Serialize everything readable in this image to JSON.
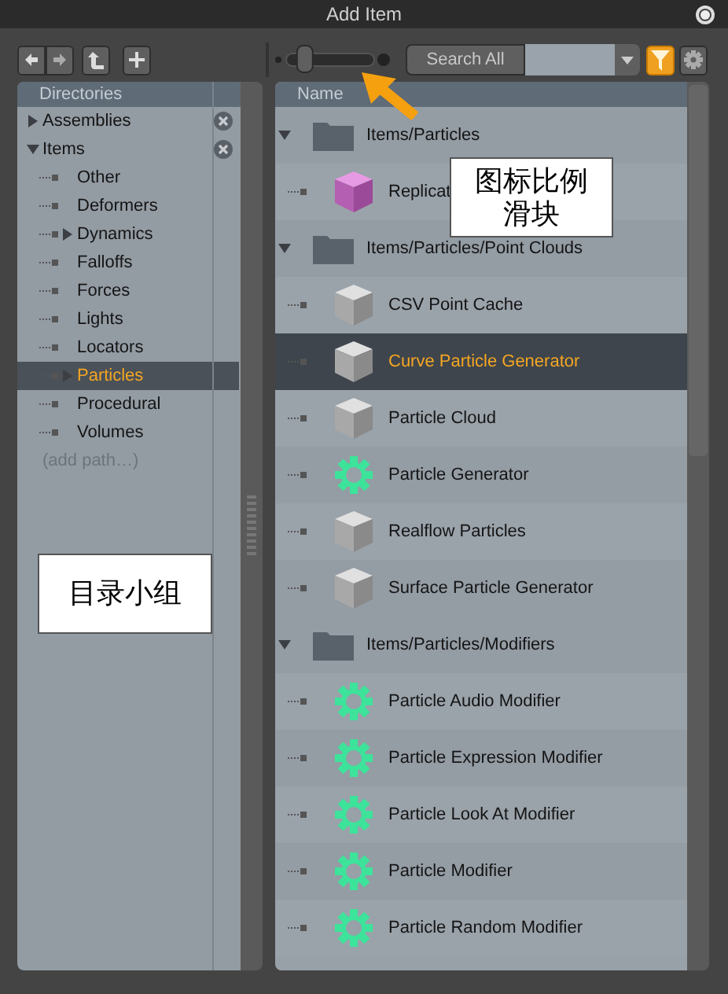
{
  "window": {
    "title": "Add Item"
  },
  "toolbar": {
    "icon_scale": {
      "level": 0.15
    },
    "search_button": "Search All",
    "filter_on": true
  },
  "directories": {
    "header": "Directories",
    "items": [
      {
        "label": "Assemblies",
        "kind": "branch",
        "expanded": false,
        "selected": false
      },
      {
        "label": "Items",
        "kind": "branch",
        "expanded": true,
        "selected": false,
        "children": [
          {
            "label": "Other",
            "kind": "leaf",
            "selected": false
          },
          {
            "label": "Deformers",
            "kind": "leaf",
            "selected": false
          },
          {
            "label": "Dynamics",
            "kind": "branch",
            "expanded": false,
            "selected": false
          },
          {
            "label": "Falloffs",
            "kind": "leaf",
            "selected": false
          },
          {
            "label": "Forces",
            "kind": "leaf",
            "selected": false
          },
          {
            "label": "Lights",
            "kind": "leaf",
            "selected": false
          },
          {
            "label": "Locators",
            "kind": "leaf",
            "selected": false
          },
          {
            "label": "Particles",
            "kind": "branch",
            "expanded": false,
            "selected": true
          },
          {
            "label": "Procedural",
            "kind": "leaf",
            "selected": false
          },
          {
            "label": "Volumes",
            "kind": "leaf",
            "selected": false
          }
        ]
      }
    ],
    "add_path": "(add path…)"
  },
  "list": {
    "column": "Name",
    "groups": [
      {
        "path": "Items/Particles",
        "expanded": true,
        "items": [
          {
            "name": "Replicat",
            "kind": "replicator",
            "selected": false
          }
        ]
      },
      {
        "path": "Items/Particles/Point Clouds",
        "expanded": true,
        "items": [
          {
            "name": "CSV Point Cache",
            "kind": "mesh",
            "selected": false
          },
          {
            "name": "Curve Particle Generator",
            "kind": "mesh",
            "selected": true
          },
          {
            "name": "Particle Cloud",
            "kind": "mesh",
            "selected": false
          },
          {
            "name": "Particle Generator",
            "kind": "modifier",
            "selected": false
          },
          {
            "name": "Realflow Particles",
            "kind": "mesh",
            "selected": false
          },
          {
            "name": "Surface Particle Generator",
            "kind": "mesh",
            "selected": false
          }
        ]
      },
      {
        "path": "Items/Particles/Modifiers",
        "expanded": true,
        "items": [
          {
            "name": "Particle Audio Modifier",
            "kind": "modifier",
            "selected": false
          },
          {
            "name": "Particle Expression Modifier",
            "kind": "modifier",
            "selected": false
          },
          {
            "name": "Particle Look At Modifier",
            "kind": "modifier",
            "selected": false
          },
          {
            "name": "Particle Modifier",
            "kind": "modifier",
            "selected": false
          },
          {
            "name": "Particle Random Modifier",
            "kind": "modifier",
            "selected": false
          }
        ]
      }
    ]
  },
  "annotations": [
    {
      "kind": "slider-note",
      "lines": [
        "图标比例",
        "滑块"
      ]
    },
    {
      "kind": "panel-note",
      "lines": [
        "目录小组"
      ]
    }
  ]
}
